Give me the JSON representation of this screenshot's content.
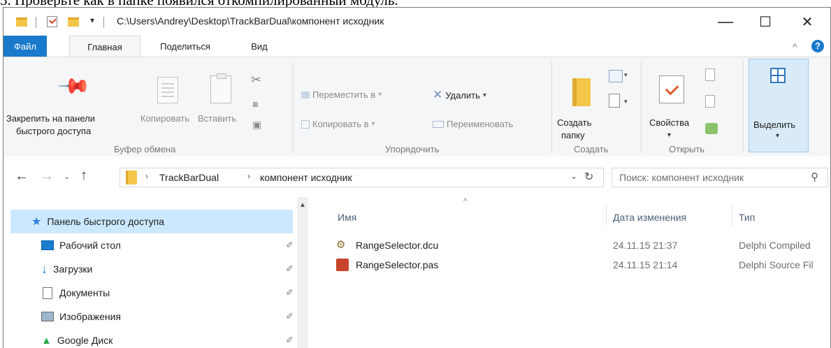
{
  "caption": "3. Проверьте как в папке появился откомпилированный модуль.",
  "titlebar": {
    "path": "C:\\Users\\Andrey\\Desktop\\TrackBarDual\\компонент исходник",
    "minimize": "—",
    "maximize": "☐",
    "close": "✕"
  },
  "tabs": [
    "Файл",
    "Главная",
    "Поделиться",
    "Вид"
  ],
  "ribbon": {
    "pin_line1": "Закрепить на панели",
    "pin_line2": "быстрого доступа",
    "copy": "Копировать",
    "paste": "Вставить",
    "clipboard_group": "Буфер обмена",
    "move_to": "Переместить в",
    "copy_to": "Копировать в",
    "delete": "Удалить",
    "rename": "Переименовать",
    "organize_group": "Упорядочить",
    "new_folder_line1": "Создать",
    "new_folder_line2": "папку",
    "create_group": "Создать",
    "properties": "Свойства",
    "open_group": "Открыть",
    "select": "Выделить",
    "collapse": "^",
    "help": "?"
  },
  "address": {
    "crumbs": [
      "TrackBarDual",
      "компонент исходник"
    ],
    "search_placeholder": "Поиск: компонент исходник"
  },
  "navpane": {
    "items": [
      {
        "label": "Панель быстрого доступа",
        "icon": "star-icon",
        "pinned": false
      },
      {
        "label": "Рабочий стол",
        "icon": "desktop-icon",
        "pinned": true
      },
      {
        "label": "Загрузки",
        "icon": "download-arrow-icon",
        "pinned": true
      },
      {
        "label": "Документы",
        "icon": "documents-icon",
        "pinned": true
      },
      {
        "label": "Изображения",
        "icon": "pictures-icon",
        "pinned": true
      },
      {
        "label": "Google Диск",
        "icon": "google-drive-icon",
        "pinned": true
      }
    ]
  },
  "filelist": {
    "columns": [
      "Имя",
      "Дата изменения",
      "Тип"
    ],
    "rows": [
      {
        "name": "RangeSelector.dcu",
        "date": "24.11.15 21:37",
        "type": "Delphi Compiled",
        "icon": "dcu-file-icon"
      },
      {
        "name": "RangeSelector.pas",
        "date": "24.11.15 21:14",
        "type": "Delphi Source Fil",
        "icon": "pas-file-icon"
      }
    ]
  },
  "colors": {
    "accent": "#1979ca",
    "selection": "#cce8ff",
    "folder": "#f3c64a"
  }
}
